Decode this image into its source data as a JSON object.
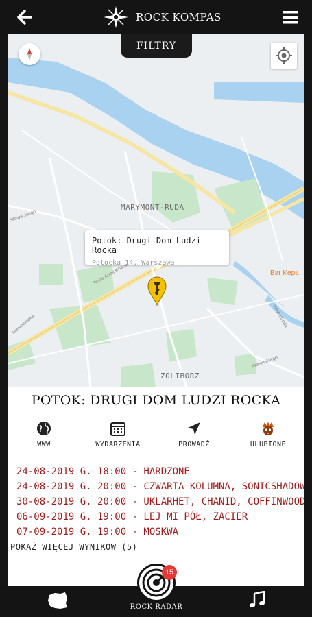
{
  "header": {
    "title": "ROCK KOMPAS"
  },
  "map": {
    "filter_label": "FILTRY",
    "district_1": "MARYMONT-RUDA",
    "district_2": "ŻOLIBORZ",
    "poi": "Bar Kępa",
    "streets": [
      "Trasa Armii Krajowej",
      "Trasa Mostu Gdańskiego",
      "Wisłostrada",
      "Krasińskiego",
      "Marymoncka",
      "Słowackiego"
    ],
    "infowindow": {
      "title": "Potok: Drugi Dom Ludzi Rocka",
      "address": "Potocka 14, Warszawa"
    }
  },
  "venue": {
    "title": "POTOK: DRUGI DOM LUDZI ROCKA",
    "actions": [
      {
        "label": "WWW",
        "icon": "globe-icon"
      },
      {
        "label": "WYDARZENIA",
        "icon": "calendar-icon"
      },
      {
        "label": "PROWADŹ",
        "icon": "navigate-icon"
      },
      {
        "label": "ULUBIONE",
        "icon": "favorite-skull-icon"
      }
    ],
    "events": [
      "24-08-2019 G. 18:00 - HARDZONE",
      "24-08-2019 G. 20:00 - CZWARTA KOLUMNA, SONICSHADOW",
      "30-08-2019 G. 20:00 - UKLARHET, CHANID, COFFINWOOD",
      "06-09-2019 G. 19:00 - LEJ MI PÓŁ, ZACIER",
      "07-09-2019 G. 19:00 - MOSKWA"
    ],
    "more_label": "POKAŻ WIĘCEJ WYNIKÓW (5)"
  },
  "bottom_nav": {
    "radar_label": "ROCK RADAR",
    "radar_badge": "15"
  },
  "colors": {
    "bar": "#141414",
    "event_text": "#9b1c1c",
    "pin": "#f2c200",
    "badge": "#e53935",
    "water": "#a8d2f0",
    "park": "#c8e6c9",
    "road": "#f6e6a5"
  }
}
